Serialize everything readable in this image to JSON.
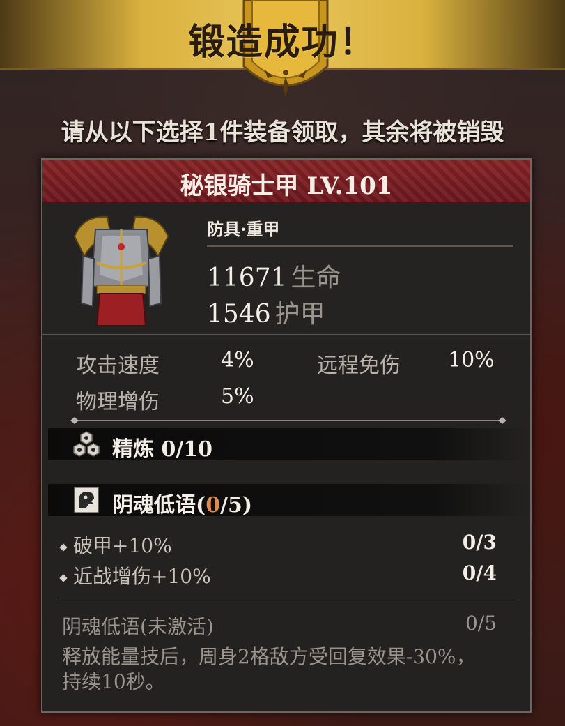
{
  "banner": {
    "title": "锻造成功！"
  },
  "subtitle": "请从以下选择1件装备领取，其余将被销毁",
  "item": {
    "name": "秘银骑士甲 LV.101",
    "type": "防具·重甲",
    "main_stats": [
      {
        "value": "11671",
        "label": "生命"
      },
      {
        "value": "1546",
        "label": "护甲"
      }
    ],
    "attributes": [
      {
        "name": "攻击速度",
        "value": "4%"
      },
      {
        "name": "远程免伤",
        "value": "10%"
      },
      {
        "name": "物理增伤",
        "value": "5%"
      }
    ]
  },
  "refine": {
    "label": "精炼 0/10"
  },
  "whisper": {
    "label_prefix": "阴魂低语(",
    "label_current": "0",
    "label_suffix": "/5)",
    "bonuses": [
      {
        "text": "破甲+10%",
        "count": "0/3"
      },
      {
        "text": "近战增伤+10%",
        "count": "0/4"
      }
    ],
    "inactive_title": "阴魂低语(未激活)",
    "inactive_count": "0/5",
    "description": "释放能量技后，周身2格敌方受回复效果-30%，持续10秒。"
  },
  "colors": {
    "header_red": "#7a1f23",
    "gold": "#e0bb4a",
    "accent_orange": "#e08a4a"
  },
  "icons": [
    "armor-icon",
    "refine-icon",
    "whisper-icon",
    "diamond-bullet-icon"
  ]
}
